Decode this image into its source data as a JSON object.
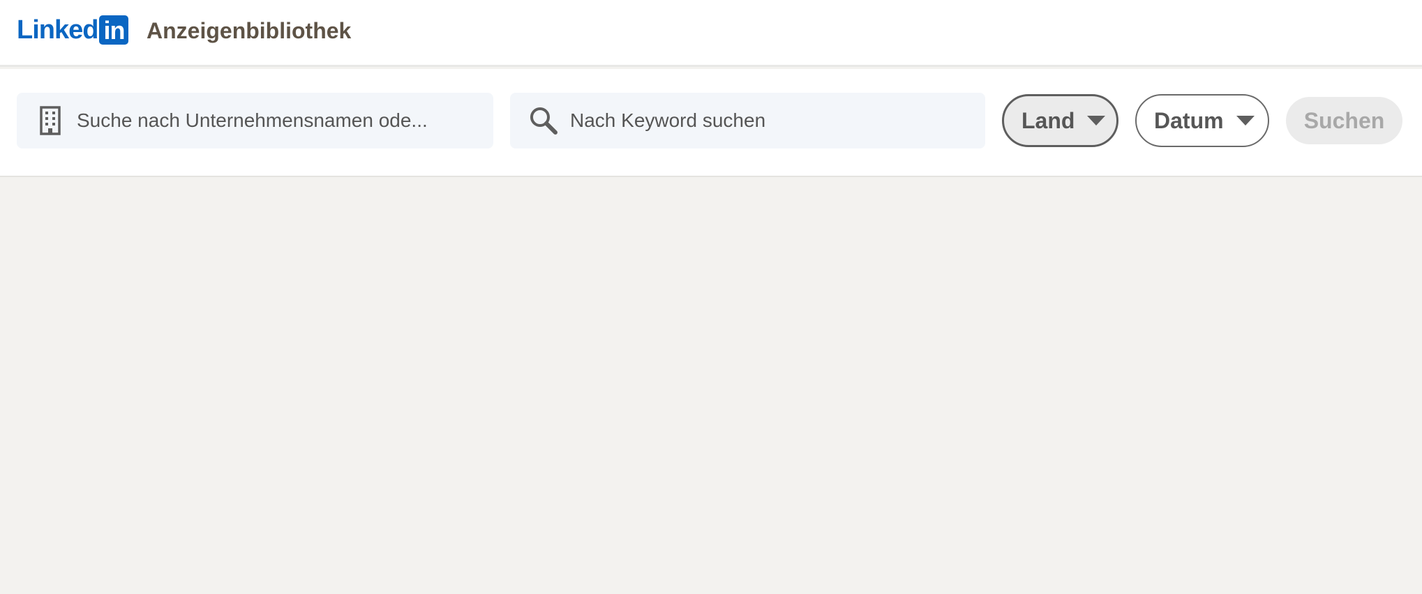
{
  "header": {
    "logo_word": "Linked",
    "logo_box": "in",
    "app_title": "Anzeigenbibliothek",
    "brand_color": "#0a66c2"
  },
  "toolbar": {
    "company_search": {
      "icon": "building-icon",
      "placeholder": "Suche nach Unternehmensnamen ode..."
    },
    "keyword_search": {
      "icon": "search-icon",
      "placeholder": "Nach Keyword suchen"
    },
    "filters": [
      {
        "label": "Land",
        "icon": "caret-down-icon",
        "active": true
      },
      {
        "label": "Datum",
        "icon": "caret-down-icon",
        "active": false
      }
    ],
    "submit": {
      "label": "Suchen",
      "disabled": true
    }
  }
}
